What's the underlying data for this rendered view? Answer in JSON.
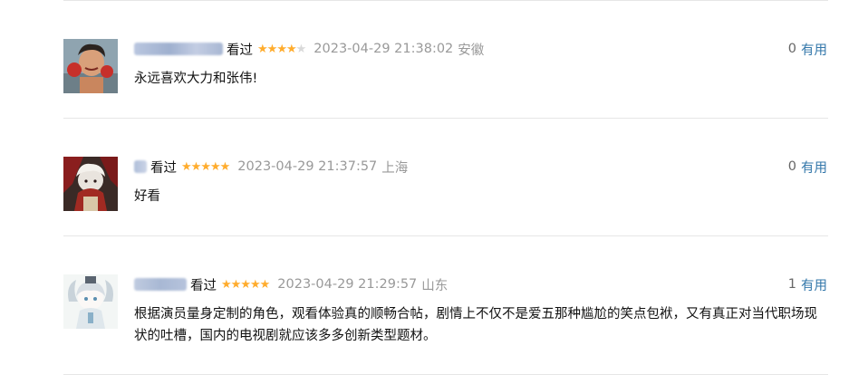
{
  "comments": [
    {
      "seen_label": "看过",
      "rating": 4,
      "time": "2023-04-29 21:38:02",
      "location": "安徽",
      "votes": "0",
      "useful_label": "有用",
      "text": "永远喜欢大力和张伟!"
    },
    {
      "seen_label": "看过",
      "rating": 5,
      "time": "2023-04-29 21:37:57",
      "location": "上海",
      "votes": "0",
      "useful_label": "有用",
      "text": "好看"
    },
    {
      "seen_label": "看过",
      "rating": 5,
      "time": "2023-04-29 21:29:57",
      "location": "山东",
      "votes": "1",
      "useful_label": "有用",
      "text": "根据演员量身定制的角色，观看体验真的顺畅合帖，剧情上不仅不是爱五那种尴尬的笑点包袱，又有真正对当代职场现状的吐槽，国内的电视剧就应该多多创新类型题材。"
    }
  ],
  "colors": {
    "star": "#ffac2d",
    "star_off": "#d9d9d9",
    "meta": "#999999",
    "link": "#3377aa",
    "divider": "#e6e6e6"
  },
  "icons": [
    "user-avatar",
    "star-icon"
  ]
}
